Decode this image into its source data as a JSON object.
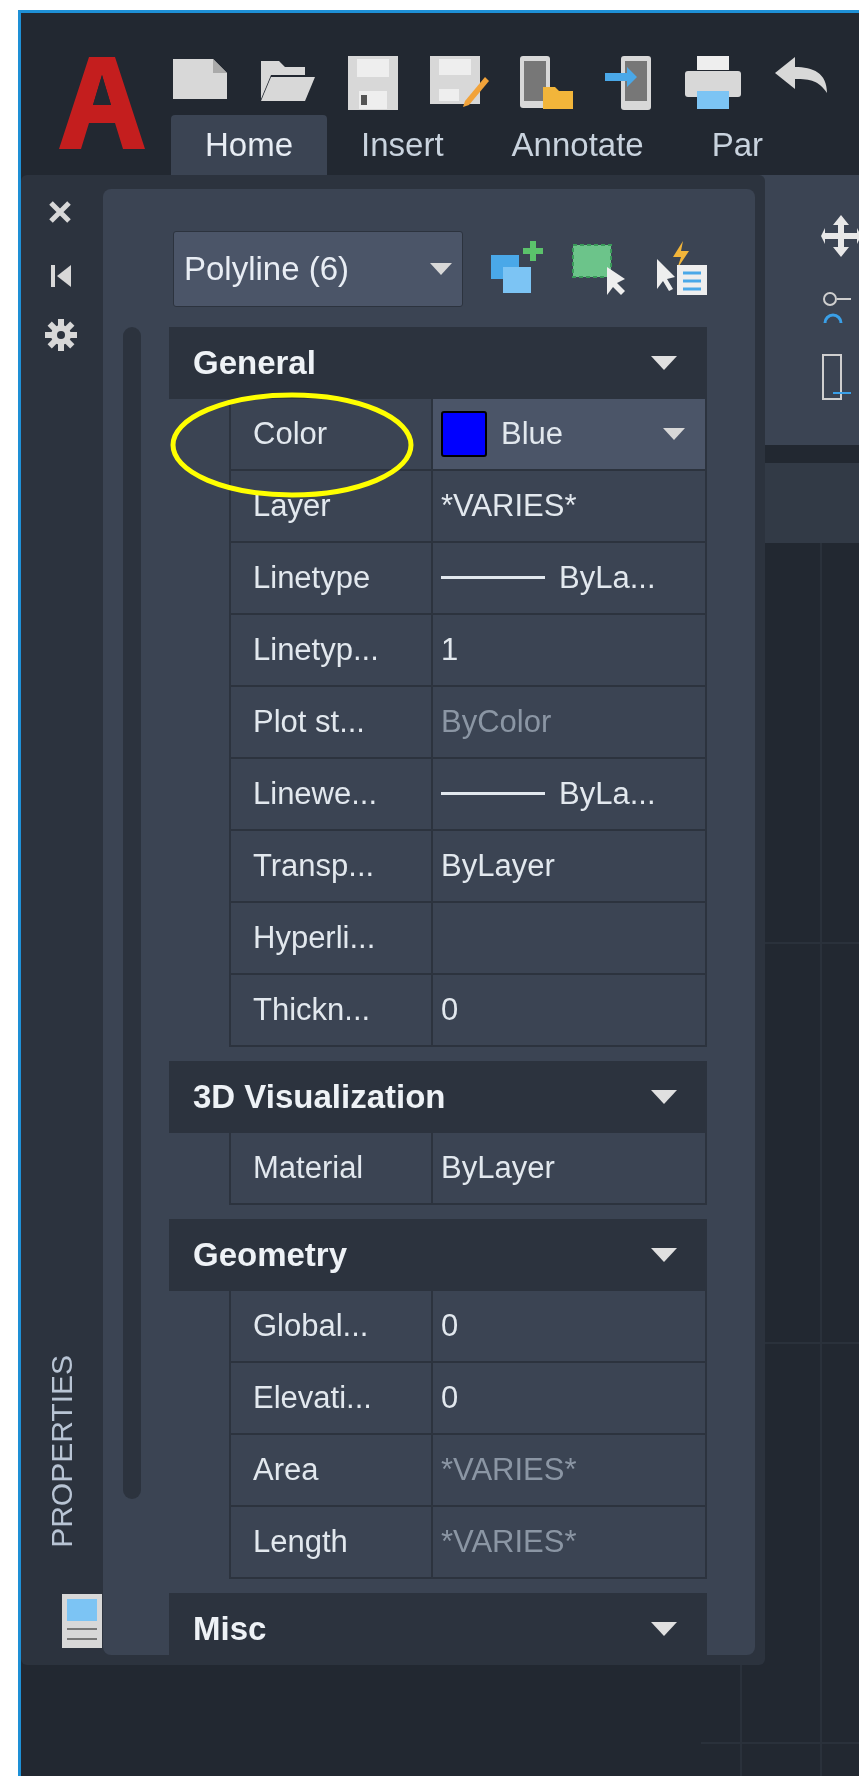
{
  "tabs": [
    {
      "label": "Home",
      "selected": true
    },
    {
      "label": "Insert",
      "selected": false
    },
    {
      "label": "Annotate",
      "selected": false
    },
    {
      "label": "Par",
      "selected": false
    }
  ],
  "palette": {
    "title": "PROPERTIES",
    "selection": "Polyline (6)",
    "sections": [
      {
        "title": "General",
        "rows": [
          {
            "label": "Color",
            "value": "Blue",
            "kind": "color",
            "color": "#0000ff",
            "disabled": false
          },
          {
            "label": "Layer",
            "value": "*VARIES*",
            "kind": "text",
            "disabled": false
          },
          {
            "label": "Linetype",
            "value": "ByLa...",
            "kind": "line",
            "disabled": false
          },
          {
            "label": "Linetyp...",
            "value": "1",
            "kind": "text",
            "disabled": false
          },
          {
            "label": "Plot st...",
            "value": "ByColor",
            "kind": "text",
            "disabled": true
          },
          {
            "label": "Linewe...",
            "value": "ByLa...",
            "kind": "line",
            "disabled": false
          },
          {
            "label": "Transp...",
            "value": "ByLayer",
            "kind": "text",
            "disabled": false
          },
          {
            "label": "Hyperli...",
            "kind": "text"
          },
          {
            "label": "Thickn...",
            "value": "0",
            "kind": "text",
            "disabled": false
          }
        ]
      },
      {
        "title": "3D Visualization",
        "rows": [
          {
            "label": "Material",
            "value": "ByLayer",
            "kind": "text",
            "disabled": false
          }
        ]
      },
      {
        "title": "Geometry",
        "rows": [
          {
            "label": "Global...",
            "value": "0",
            "kind": "text",
            "disabled": false
          },
          {
            "label": "Elevati...",
            "value": "0",
            "kind": "text",
            "disabled": false
          },
          {
            "label": "Area",
            "value": "*VARIES*",
            "kind": "text",
            "disabled": true
          },
          {
            "label": "Length",
            "value": "*VARIES*",
            "kind": "text",
            "disabled": true
          }
        ]
      },
      {
        "title": "Misc"
      }
    ]
  }
}
